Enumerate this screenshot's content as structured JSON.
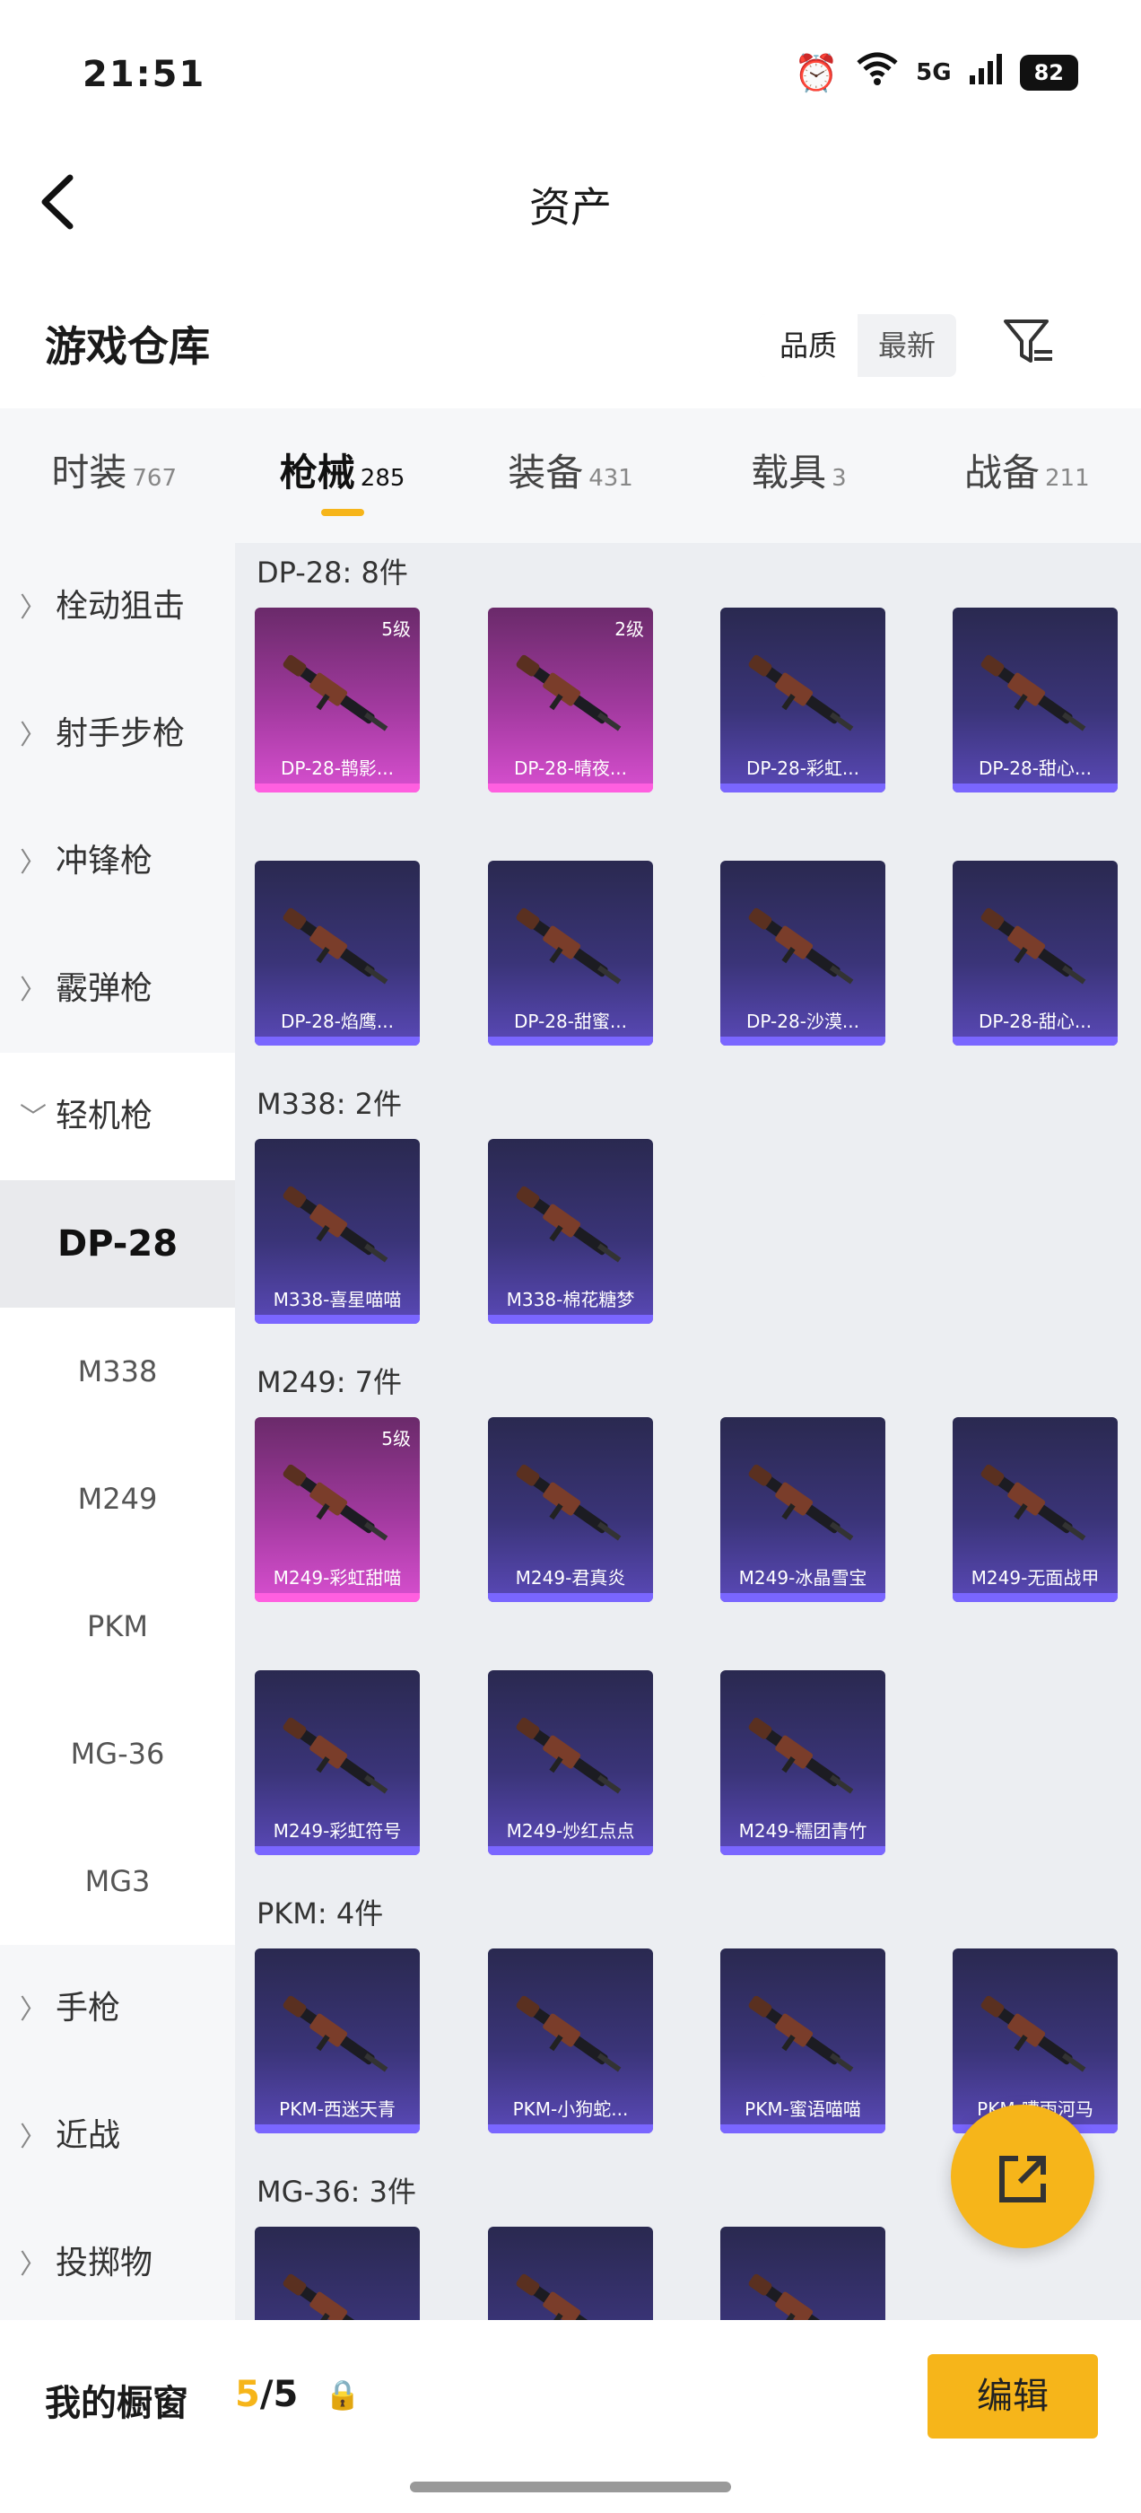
{
  "status": {
    "time": "21:51",
    "network": "5G",
    "battery": "82"
  },
  "header": {
    "title": "资产"
  },
  "warehouse": {
    "title": "游戏仓库",
    "sort_options": [
      "品质",
      "最新"
    ],
    "sort_selected": "品质"
  },
  "tabs": [
    {
      "label": "时装",
      "count": "767"
    },
    {
      "label": "枪械",
      "count": "285",
      "active": true
    },
    {
      "label": "装备",
      "count": "431"
    },
    {
      "label": "载具",
      "count": "3"
    },
    {
      "label": "战备",
      "count": "211"
    }
  ],
  "sidebar": {
    "categories": [
      "栓动狙击",
      "射手步枪",
      "冲锋枪",
      "霰弹枪",
      "轻机枪"
    ],
    "sub_items": [
      "DP-28",
      "M338",
      "M249",
      "PKM",
      "MG-36",
      "MG3"
    ],
    "more_categories": [
      "手枪",
      "近战",
      "投掷物"
    ]
  },
  "groups": [
    {
      "label": "DP-28: 8件",
      "items": [
        {
          "name": "DP-28-鹊影...",
          "level": "5级",
          "rarity": "pink"
        },
        {
          "name": "DP-28-晴夜...",
          "level": "2级",
          "rarity": "pink"
        },
        {
          "name": "DP-28-彩虹...",
          "rarity": "purple"
        },
        {
          "name": "DP-28-甜心...",
          "rarity": "purple"
        },
        {
          "name": "DP-28-焰鹰...",
          "rarity": "purple"
        },
        {
          "name": "DP-28-甜蜜...",
          "rarity": "purple"
        },
        {
          "name": "DP-28-沙漠...",
          "rarity": "purple"
        },
        {
          "name": "DP-28-甜心...",
          "rarity": "purple"
        }
      ]
    },
    {
      "label": "M338: 2件",
      "items": [
        {
          "name": "M338-喜星喵喵",
          "rarity": "purple"
        },
        {
          "name": "M338-棉花糖梦",
          "rarity": "purple"
        }
      ]
    },
    {
      "label": "M249: 7件",
      "items": [
        {
          "name": "M249-彩虹甜喵",
          "level": "5级",
          "rarity": "pink"
        },
        {
          "name": "M249-君真炎",
          "rarity": "purple"
        },
        {
          "name": "M249-冰晶雪宝",
          "rarity": "purple"
        },
        {
          "name": "M249-无面战甲",
          "rarity": "purple"
        },
        {
          "name": "M249-彩虹符号",
          "rarity": "purple"
        },
        {
          "name": "M249-炒红点点",
          "rarity": "purple"
        },
        {
          "name": "M249-糯团青竹",
          "rarity": "purple"
        }
      ]
    },
    {
      "label": "PKM: 4件",
      "items": [
        {
          "name": "PKM-西迷天青",
          "rarity": "purple"
        },
        {
          "name": "PKM-小狗蛇...",
          "rarity": "purple"
        },
        {
          "name": "PKM-蜜语喵喵",
          "rarity": "purple"
        },
        {
          "name": "PKM-嘈雨河马",
          "rarity": "purple"
        }
      ]
    },
    {
      "label": "MG-36: 3件",
      "items": [
        {
          "name": "",
          "rarity": "purple"
        },
        {
          "name": "",
          "rarity": "purple"
        },
        {
          "name": "",
          "rarity": "purple"
        }
      ]
    }
  ],
  "bottom": {
    "showcase_label": "我的橱窗",
    "slots_current": "5",
    "slots_total": "/5",
    "edit_label": "编辑"
  },
  "colors": {
    "accent": "#f6b51a",
    "purple_card": "#3a3478",
    "pink_card": "#a33aa0"
  }
}
